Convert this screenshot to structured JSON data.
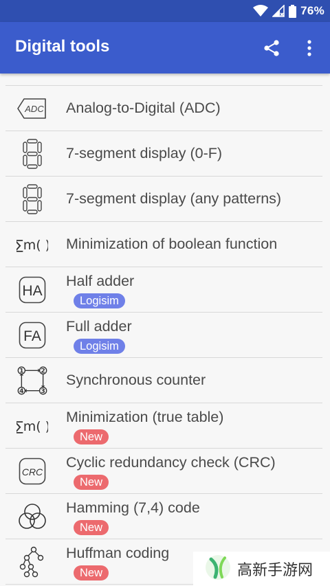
{
  "status_bar": {
    "battery_percent": "76%",
    "icons": [
      "wifi-icon",
      "signal-icon",
      "battery-icon"
    ]
  },
  "app_bar": {
    "title": "Digital tools",
    "actions": [
      "share-icon",
      "more-vert-icon"
    ]
  },
  "items": [
    {
      "label": "Analog-to-Digital (ADC)",
      "icon": "adc-icon"
    },
    {
      "label": "7-segment display (0-F)",
      "icon": "seven-segment-icon"
    },
    {
      "label": "7-segment display (any patterns)",
      "icon": "seven-segment-icon"
    },
    {
      "label": "Minimization of boolean function",
      "icon": "sum-minterm-icon",
      "icon_text": "∑m( )"
    },
    {
      "label": "Half adder",
      "icon": "half-adder-icon",
      "icon_text": "HA",
      "badge": "Logisim"
    },
    {
      "label": "Full adder",
      "icon": "full-adder-icon",
      "icon_text": "FA",
      "badge": "Logisim"
    },
    {
      "label": "Synchronous counter",
      "icon": "counter-cycle-icon"
    },
    {
      "label": "Minimization (true table)",
      "icon": "sum-minterm-icon",
      "icon_text": "∑m( )",
      "badge": "New"
    },
    {
      "label": "Cyclic redundancy check (CRC)",
      "icon": "crc-icon",
      "icon_text": "CRC",
      "badge": "New"
    },
    {
      "label": "Hamming (7,4) code",
      "icon": "hamming-circles-icon",
      "badge": "New"
    },
    {
      "label": "Huffman coding",
      "icon": "huffman-tree-icon",
      "badge": "New"
    }
  ],
  "watermark": {
    "text": "高新手游网"
  },
  "colors": {
    "status_bar": "#2f4fb0",
    "app_bar": "#3b5ccc",
    "badge_logisim": "#6f80e8",
    "badge_new": "#ec6a6e"
  }
}
